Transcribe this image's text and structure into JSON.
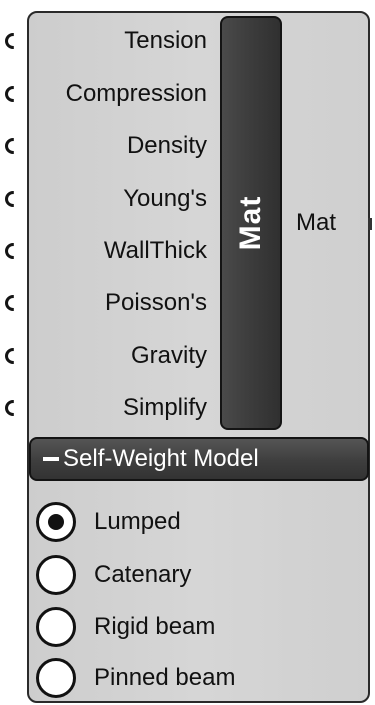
{
  "component": {
    "inputs": [
      {
        "label": "Tension"
      },
      {
        "label": "Compression"
      },
      {
        "label": "Density"
      },
      {
        "label": "Young's"
      },
      {
        "label": "WallThick"
      },
      {
        "label": "Poisson's"
      },
      {
        "label": "Gravity"
      },
      {
        "label": "Simplify"
      }
    ],
    "name_bar": "Mat",
    "output": {
      "label": "Mat"
    },
    "section": {
      "title": "Self-Weight Model",
      "options": [
        {
          "label": "Lumped",
          "selected": true
        },
        {
          "label": "Catenary",
          "selected": false
        },
        {
          "label": "Rigid beam",
          "selected": false
        },
        {
          "label": "Pinned beam",
          "selected": false
        }
      ]
    }
  }
}
